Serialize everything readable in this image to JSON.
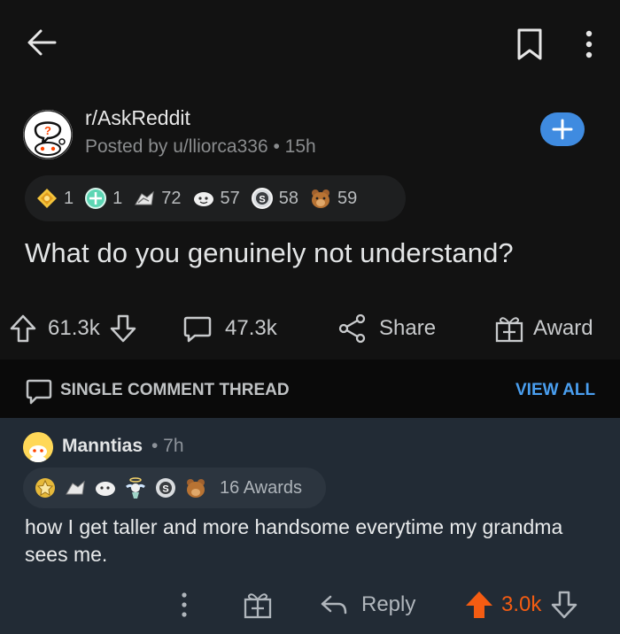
{
  "post": {
    "subreddit": "r/AskReddit",
    "posted_by": "Posted by u/lliorca336 • 15h",
    "title": "What do you genuinely not understand?",
    "awards": [
      {
        "icon": "gold-award-icon",
        "count": "1"
      },
      {
        "icon": "argentium-award-icon",
        "count": "1"
      },
      {
        "icon": "wholesome-award-icon",
        "count": "72"
      },
      {
        "icon": "helpful-award-icon",
        "count": "57"
      },
      {
        "icon": "silver-award-icon",
        "count": "58"
      },
      {
        "icon": "bear-award-icon",
        "count": "59"
      }
    ],
    "upvotes": "61.3k",
    "comments": "47.3k",
    "share_label": "Share",
    "award_label": "Award"
  },
  "thread": {
    "label": "SINGLE COMMENT THREAD",
    "view_all": "VIEW ALL"
  },
  "comment": {
    "username": "Manntias",
    "time": "• 7h",
    "awards_label": "16 Awards",
    "body": "how I get taller and more handsome everytime my grandma sees me.",
    "reply_label": "Reply",
    "score": "3.0k"
  },
  "colors": {
    "background": "#121212",
    "comment_bg": "#222b35",
    "accent_blue": "#3f8be0",
    "upvote_orange": "#f45c12"
  }
}
